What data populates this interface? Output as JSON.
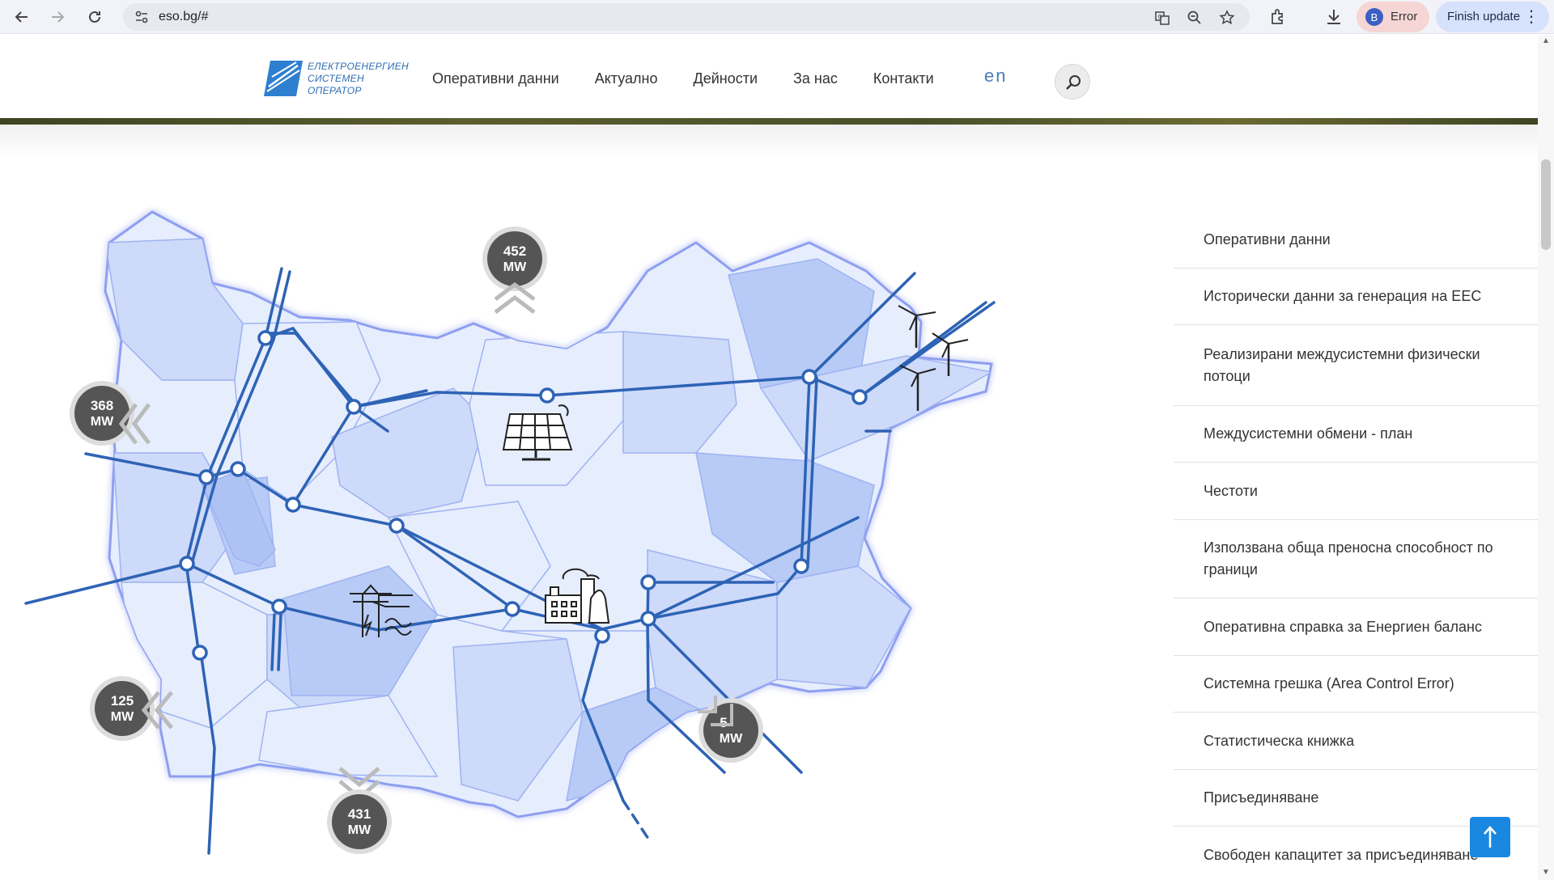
{
  "browser": {
    "url": "eso.bg/#",
    "profile_initial": "B",
    "profile_status": "Error",
    "update_label": "Finish update"
  },
  "site": {
    "logo_lines": [
      "ЕЛЕКТРОЕНЕРГИЕН",
      "СИСТЕМЕН",
      "ОПЕРАТОР"
    ],
    "nav": [
      "Оперативни данни",
      "Актуално",
      "Дейности",
      "За нас",
      "Контакти"
    ],
    "lang": "en"
  },
  "map": {
    "flows": {
      "north": {
        "value": "452",
        "unit": "MW"
      },
      "west": {
        "value": "368",
        "unit": "MW"
      },
      "southwest": {
        "value": "125",
        "unit": "MW"
      },
      "south": {
        "value": "431",
        "unit": "MW"
      },
      "southeast": {
        "value": "5",
        "unit": "MW"
      }
    }
  },
  "sidebar": {
    "items": [
      "Оперативни данни",
      "Исторически данни за генерация на ЕЕС",
      "Реализирани междусистемни физически потоци",
      "Междусистемни обмени - план",
      "Честоти",
      "Използвана обща преносна способност по граници",
      "Оперативна справка за Енергиен баланс",
      "Системна грешка (Area Control Error)",
      "Статистическа книжка",
      "Присъединяване",
      "Свободен капацитет за присъединяване"
    ]
  },
  "colors": {
    "accent": "#1a88e0",
    "grid_line": "#2e63b5",
    "region_light": "#e6edfd",
    "region_mid": "#cddaf9",
    "region_dark": "#b7cbf6"
  }
}
